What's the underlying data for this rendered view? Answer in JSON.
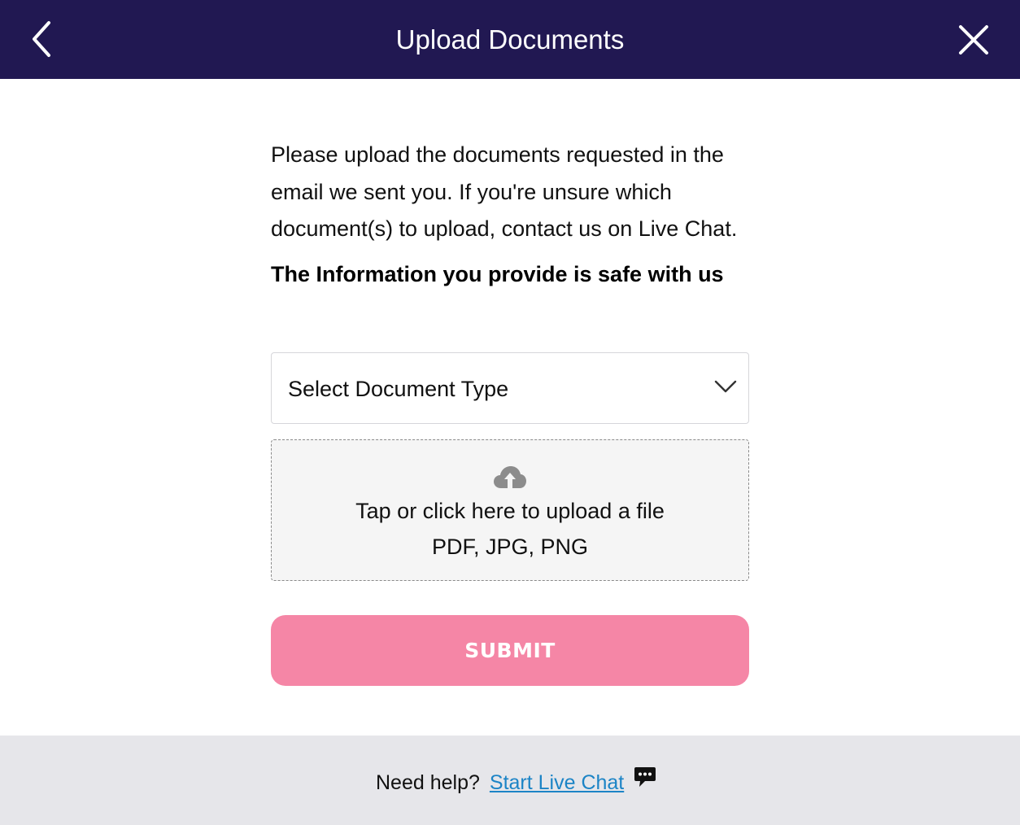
{
  "header": {
    "title": "Upload Documents",
    "back_icon": "chevron-left-icon",
    "close_icon": "close-icon",
    "background": "#211852"
  },
  "content": {
    "intro": "Please upload the documents requested in the email we sent you. If you're unsure which document(s) to upload, contact us on Live Chat.",
    "safe_note": "The Information you provide is safe with us"
  },
  "document_select": {
    "selected": "Select Document Type",
    "icon": "chevron-down-icon"
  },
  "upload": {
    "icon": "cloud-upload-icon",
    "label": "Tap or click here to upload a file",
    "formats": "PDF, JPG, PNG"
  },
  "submit": {
    "label": "SUBMIT",
    "color": "#f586a6"
  },
  "footer": {
    "help_text": "Need help?",
    "chat_link": "Start Live Chat",
    "chat_icon": "chat-bubble-icon",
    "link_color": "#1c84c6",
    "background": "#e6e6ea"
  }
}
